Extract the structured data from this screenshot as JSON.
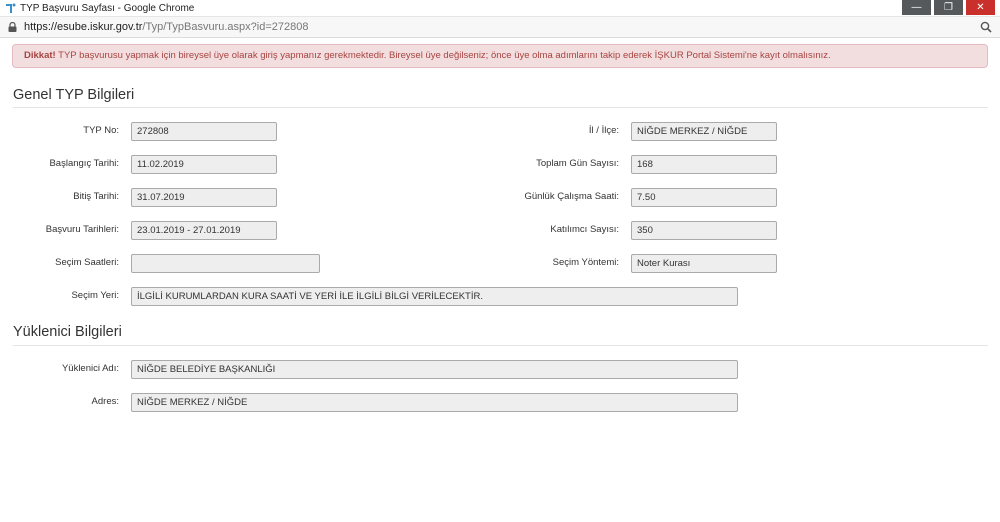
{
  "window": {
    "title": "TYP Başvuru Sayfası - Google Chrome",
    "minimize_glyph": "—",
    "restore_glyph": "❐",
    "close_glyph": "✕"
  },
  "address": {
    "host": "https://esube.iskur.gov.tr",
    "path": "/Typ/TypBasvuru.aspx?id=272808"
  },
  "alert": {
    "strong": "Dikkat!",
    "text": " TYP başvurusu yapmak için bireysel üye olarak giriş yapmanız gerekmektedir. Bireysel üye değilseniz; önce üye olma adımlarını takip ederek İŞKUR Portal Sistemi'ne kayıt olmalısınız."
  },
  "genel": {
    "title": "Genel TYP Bilgileri",
    "typ_no": {
      "label": "TYP No:",
      "value": "272808"
    },
    "il_ilce": {
      "label": "İl / İlçe:",
      "value": "NİĞDE MERKEZ / NİĞDE"
    },
    "baslangic": {
      "label": "Başlangıç Tarihi:",
      "value": "11.02.2019"
    },
    "toplam_gun": {
      "label": "Toplam Gün Sayısı:",
      "value": "168"
    },
    "bitis": {
      "label": "Bitiş Tarihi:",
      "value": "31.07.2019"
    },
    "gunluk_saat": {
      "label": "Günlük Çalışma Saati:",
      "value": "7.50"
    },
    "basvuru_tarihleri": {
      "label": "Başvuru Tarihleri:",
      "value": "23.01.2019 - 27.01.2019"
    },
    "katilimci": {
      "label": "Katılımcı Sayısı:",
      "value": "350"
    },
    "secim_saatleri": {
      "label": "Seçim Saatleri:",
      "value": ""
    },
    "secim_yontemi": {
      "label": "Seçim Yöntemi:",
      "value": "Noter Kurası"
    },
    "secim_yeri": {
      "label": "Seçim Yeri:",
      "value": "İLGİLİ KURUMLARDAN  KURA SAATİ VE YERİ İLE İLGİLİ BİLGİ VERİLECEKTİR."
    }
  },
  "yuklenici": {
    "title": "Yüklenici Bilgileri",
    "adi": {
      "label": "Yüklenici Adı:",
      "value": "NİĞDE BELEDİYE BAŞKANLIĞI"
    },
    "adres": {
      "label": "Adres:",
      "value": "NİĞDE MERKEZ / NİĞDE"
    }
  },
  "colors": {
    "alert_bg": "#f2dede",
    "alert_text": "#a94442",
    "field_bg": "#eeeeee",
    "close_button": "#c9302c"
  }
}
